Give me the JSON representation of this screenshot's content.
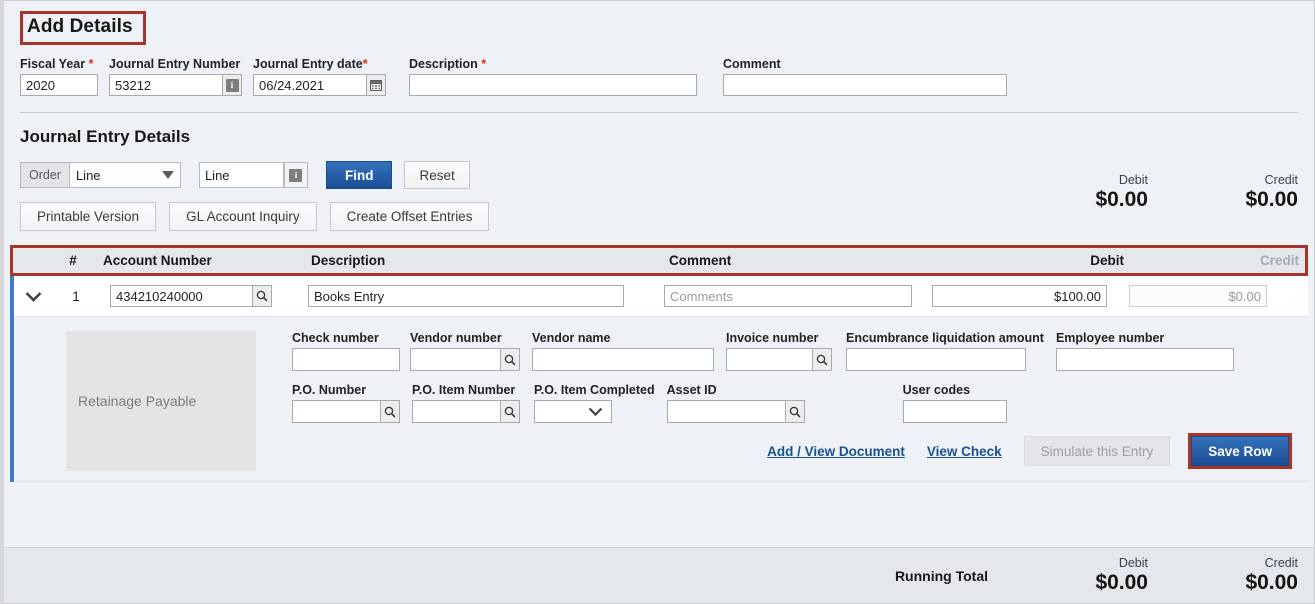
{
  "header": {
    "title": "Add Details",
    "fields": [
      {
        "label": "Fiscal Year",
        "required": true,
        "value": "2020",
        "placeholder": ""
      },
      {
        "label": "Journal Entry Number",
        "required": false,
        "value": "53212",
        "placeholder": ""
      },
      {
        "label": "Journal Entry date",
        "required": true,
        "value": "06/24.2021",
        "placeholder": ""
      },
      {
        "label": "Description",
        "required": true,
        "value": "",
        "placeholder": ""
      },
      {
        "label": "Comment",
        "required": false,
        "value": "",
        "placeholder": ""
      }
    ]
  },
  "details": {
    "section_title": "Journal Entry Details",
    "order_label": "Order",
    "order_value": "Line",
    "order_options": [
      "Line"
    ],
    "filter_value": "Line",
    "find_label": "Find",
    "reset_label": "Reset",
    "printable_label": "Printable Version",
    "gl_inquiry_label": "GL Account Inquiry",
    "offset_label": "Create Offset Entries",
    "totals": {
      "debit_label": "Debit",
      "debit_value": "$0.00",
      "credit_label": "Credit",
      "credit_value": "$0.00"
    }
  },
  "table": {
    "columns": {
      "num": "#",
      "account_number": "Account Number",
      "description": "Description",
      "comment": "Comment",
      "debit": "Debit",
      "credit": "Credit"
    },
    "rows": [
      {
        "line": "1",
        "account_number": "434210240000",
        "description": "Books Entry",
        "comment_value": "",
        "comment_placeholder": "Comments",
        "debit": "$100.00",
        "credit_placeholder": "$0.00",
        "credit": ""
      }
    ]
  },
  "expanded": {
    "account_name": "Retainage Payable",
    "row1": [
      {
        "label": "Check number",
        "value": "",
        "lookup": false,
        "width": 108
      },
      {
        "label": "Vendor number",
        "value": "",
        "lookup": true,
        "width": 92
      },
      {
        "label": "Vendor name",
        "value": "",
        "lookup": false,
        "width": 182
      },
      {
        "label": "Invoice number",
        "value": "",
        "lookup": true,
        "width": 88
      },
      {
        "label": "Encumbrance liquidation amount",
        "value": "",
        "lookup": false,
        "width": 180
      },
      {
        "label": "Employee number",
        "value": "",
        "lookup": false,
        "width": 178
      }
    ],
    "row2": [
      {
        "label": "P.O. Number",
        "value": "",
        "lookup": true,
        "width": 90
      },
      {
        "label": "P.O. Item Number",
        "value": "",
        "lookup": true,
        "width": 90
      },
      {
        "label": "P.O. Item Completed",
        "value": "",
        "select": true,
        "width": 78
      },
      {
        "label": "Asset ID",
        "value": "",
        "lookup": true,
        "width": 120
      },
      {
        "label": "User codes",
        "value": "",
        "lookup": false,
        "width": 104
      }
    ],
    "actions": {
      "add_view_document": "Add / View Document",
      "view_check": "View Check",
      "simulate": "Simulate this Entry",
      "save_row": "Save Row"
    }
  },
  "footer": {
    "running_total_label": "Running Total",
    "debit_label": "Debit",
    "debit_value": "$0.00",
    "credit_label": "Credit",
    "credit_value": "$0.00"
  },
  "colors": {
    "highlight": "#a5342b",
    "primary": "#1b4e94",
    "accent_bar": "#3d7bc4",
    "page_bg": "#eef1f5",
    "required": "#e02c20"
  }
}
